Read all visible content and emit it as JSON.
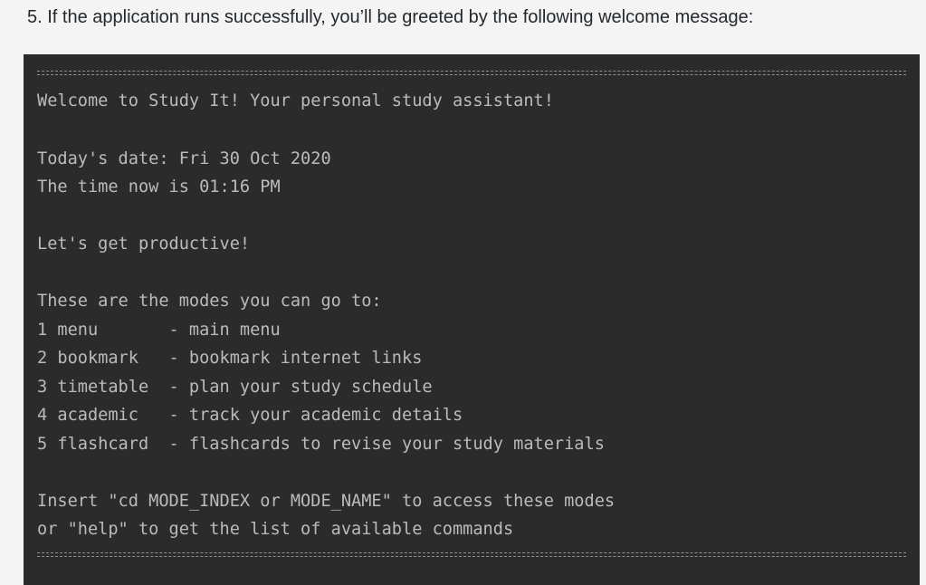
{
  "instruction": "5. If the application runs successfully, you’ll be greeted by the following welcome message:",
  "terminal": {
    "separator": "==========================================================================================",
    "welcome": "Welcome to Study It! Your personal study assistant!",
    "date_line": "Today's date: Fri 30 Oct 2020",
    "time_line": "The time now is 01:16 PM",
    "productive": "Let's get productive!",
    "modes_header": "These are the modes you can go to:",
    "modes": [
      "1 menu       - main menu",
      "2 bookmark   - bookmark internet links",
      "3 timetable  - plan your study schedule",
      "4 academic   - track your academic details",
      "5 flashcard  - flashcards to revise your study materials"
    ],
    "insert_line": "Insert \"cd MODE_INDEX or MODE_NAME\" to access these modes",
    "help_line": "or \"help\" to get the list of available commands"
  }
}
